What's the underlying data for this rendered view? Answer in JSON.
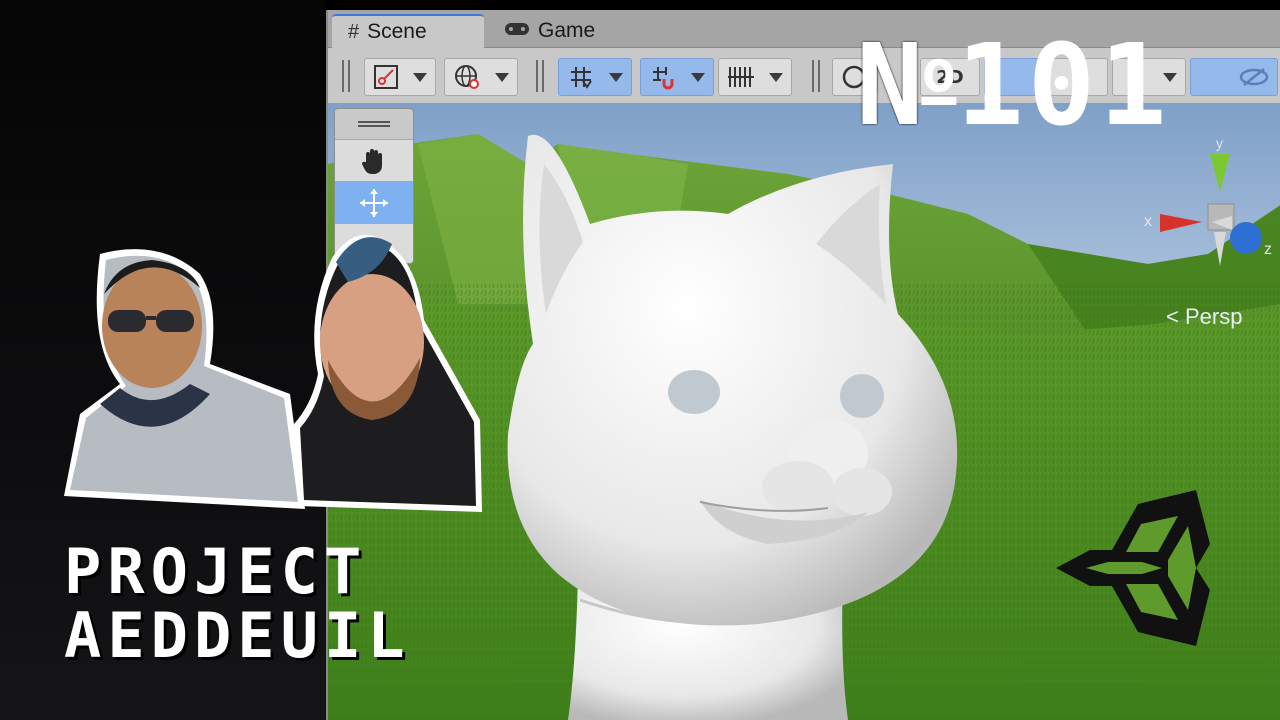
{
  "overlay": {
    "episode_prefix": "N",
    "episode_superscript": "o",
    "episode_number": "101",
    "project_line_1": "PROJECT",
    "project_line_2": "AEDDEUIL"
  },
  "editor": {
    "tabs": [
      {
        "label": "Scene",
        "icon": "hash-icon",
        "active": true
      },
      {
        "label": "Game",
        "icon": "gamepad-icon",
        "active": false
      }
    ],
    "toolbar": {
      "items": [
        "draw-mode",
        "global-lighting",
        "grid-snapping",
        "increment-snap",
        "grid-visibility",
        "camera-settings",
        "2d-toggle"
      ],
      "label_2d": "2D"
    },
    "palette": [
      "hand-icon",
      "move-icon",
      "rotate-icon"
    ],
    "projection_label": "< Persp",
    "gizmo": {
      "x": "x",
      "y": "y",
      "z": "z"
    }
  },
  "colors": {
    "accent_blue": "#7fb1f0",
    "grass": "#5c9a2a",
    "toolbar_bg": "#c8c8c8"
  }
}
